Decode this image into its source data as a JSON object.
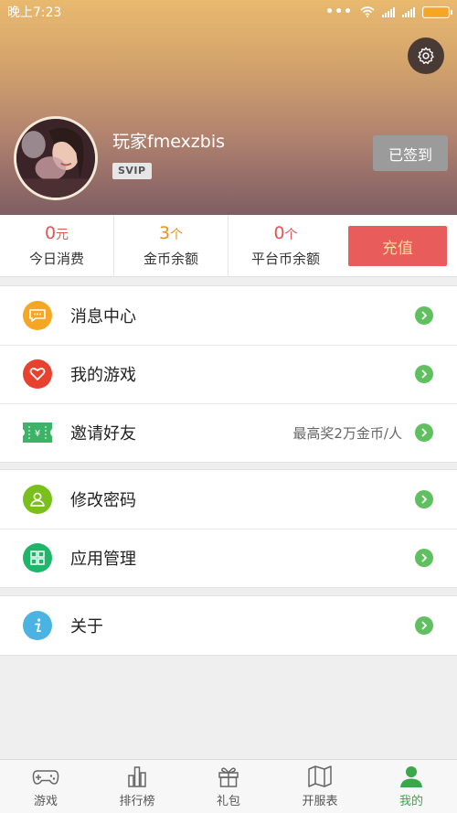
{
  "status_bar": {
    "time": "晚上7:23",
    "dots": "•••"
  },
  "profile": {
    "username": "玩家fmexzbis",
    "vip_badge": "SVIP",
    "signed_button": "已签到"
  },
  "stats": [
    {
      "value": "0",
      "unit": "元",
      "label": "今日消费"
    },
    {
      "value": "3",
      "unit": "个",
      "label": "金币余额"
    },
    {
      "value": "0",
      "unit": "个",
      "label": "平台币余额"
    }
  ],
  "recharge_button": "充值",
  "menu": {
    "message_center": {
      "label": "消息中心"
    },
    "my_games": {
      "label": "我的游戏"
    },
    "invite_friends": {
      "label": "邀请好友",
      "extra": "最高奖2万金币/人"
    },
    "change_password": {
      "label": "修改密码"
    },
    "app_management": {
      "label": "应用管理"
    },
    "about": {
      "label": "关于"
    }
  },
  "bottom_nav": [
    {
      "label": "游戏",
      "icon": "gamepad-icon"
    },
    {
      "label": "排行榜",
      "icon": "bar-chart-icon"
    },
    {
      "label": "礼包",
      "icon": "gift-icon"
    },
    {
      "label": "开服表",
      "icon": "map-icon"
    },
    {
      "label": "我的",
      "icon": "user-icon",
      "active": true
    }
  ],
  "colors": {
    "accent_green": "#3aa74a",
    "recharge_red": "#e85c5c",
    "stat_red": "#e05555",
    "stat_orange": "#e5931c"
  }
}
